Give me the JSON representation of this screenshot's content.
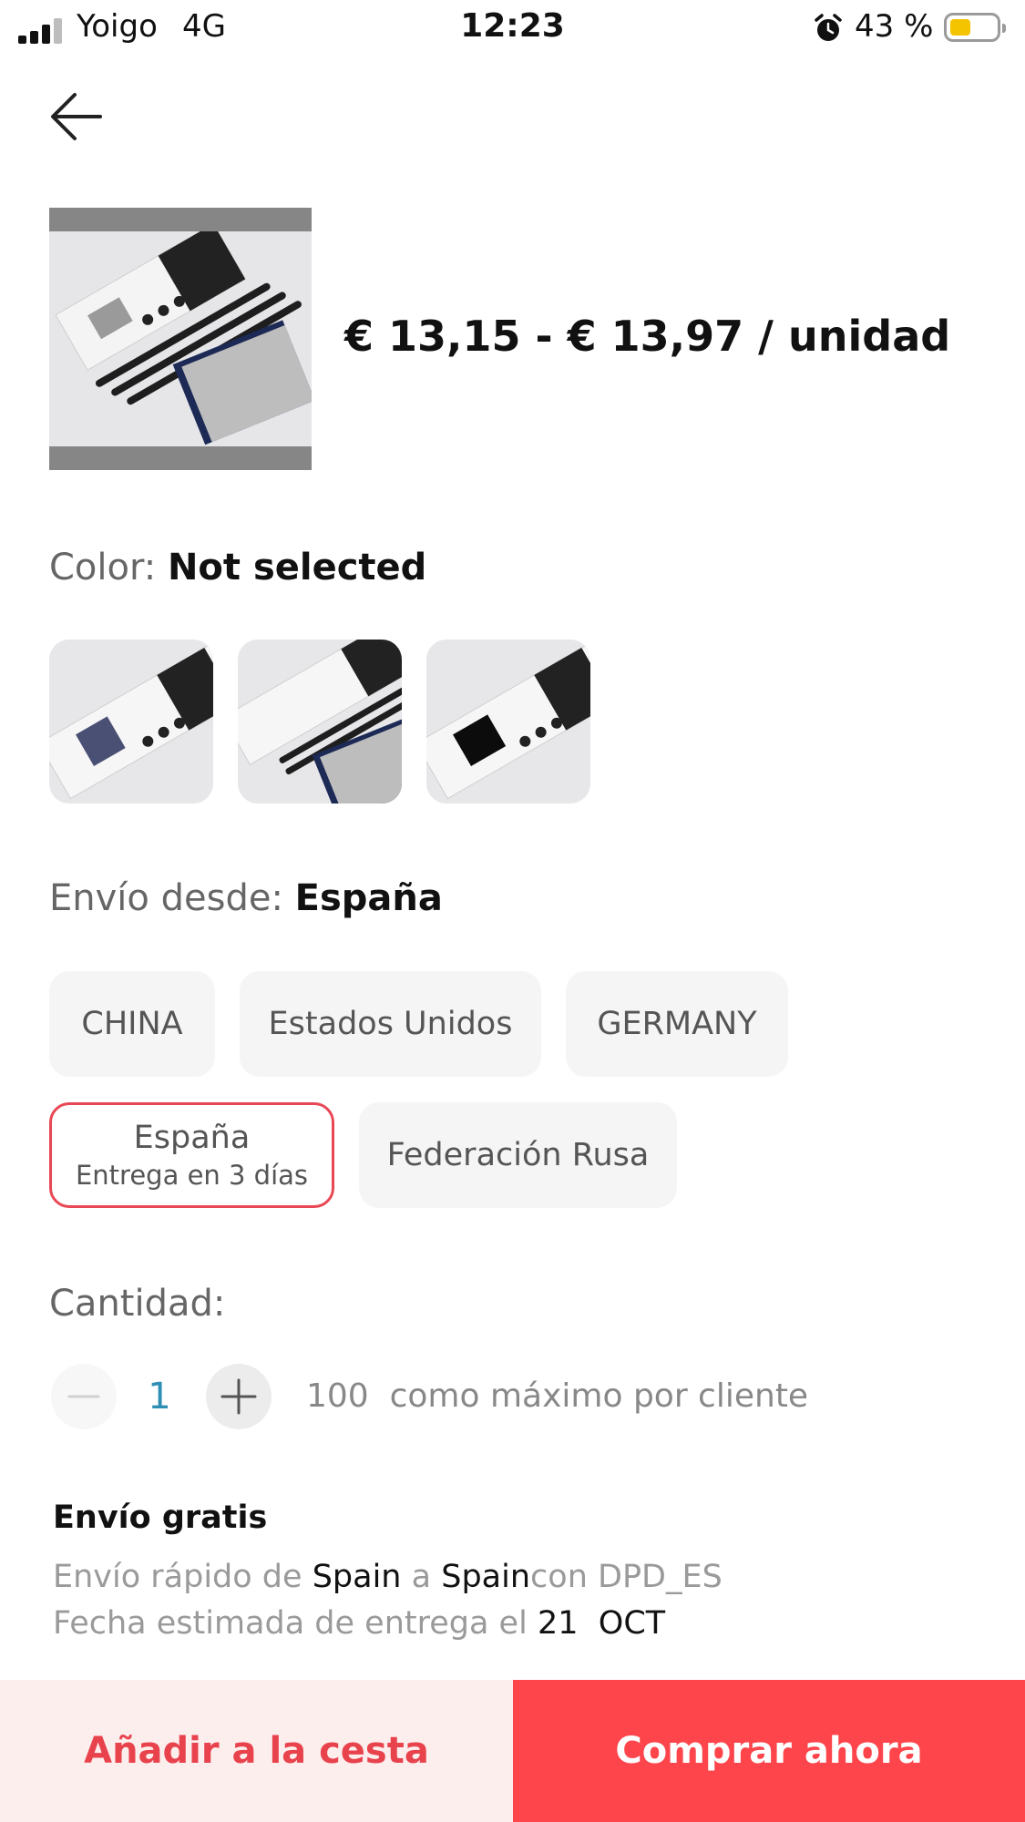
{
  "status_bar": {
    "carrier": "Yoigo",
    "network": "4G",
    "time": "12:23",
    "battery_percent": "43 %",
    "battery_color": "#f5c400",
    "signal_bars_active": 3
  },
  "nav": {
    "back_icon": "arrow-left-icon"
  },
  "product": {
    "price_range": "€ 13,15 - € 13,97 / unidad"
  },
  "color": {
    "label": "Color:",
    "value": "Not selected",
    "options": [
      "option-1",
      "option-2",
      "option-3"
    ]
  },
  "shipping_from": {
    "label": "Envío desde:",
    "value": "España",
    "options": [
      {
        "label": "CHINA"
      },
      {
        "label": "Estados Unidos"
      },
      {
        "label": "GERMANY"
      },
      {
        "label": "España",
        "sub": "Entrega en 3 días",
        "selected": true
      },
      {
        "label": "Federación Rusa"
      }
    ]
  },
  "quantity": {
    "label": "Cantidad:",
    "value": "1",
    "max_number": "100",
    "max_text": "como máximo por cliente"
  },
  "shipping_info": {
    "title": "Envío gratis",
    "line1_prefix": "Envío rápido de",
    "origin": "Spain",
    "line1_mid": "a",
    "destination": "Spain",
    "carrier": "con DPD_ES",
    "line2_prefix": "Fecha estimada de entrega el",
    "date_day": "21",
    "date_month": "OCT"
  },
  "actions": {
    "add_to_cart": "Añadir a la cesta",
    "buy_now": "Comprar ahora",
    "accent_color": "#fd454b"
  }
}
